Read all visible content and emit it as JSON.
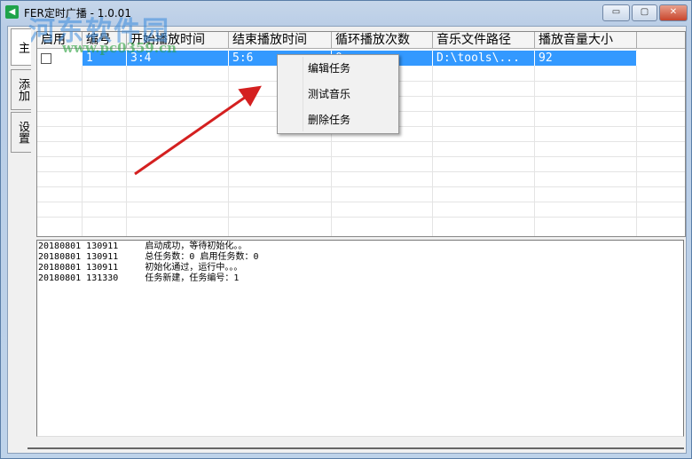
{
  "window": {
    "title": "FER定时广播 - 1.0.01",
    "minimize": "▭",
    "maximize": "▢",
    "close": "✕"
  },
  "tabs": [
    "主",
    "添加",
    "设置"
  ],
  "table": {
    "headers": [
      "启用",
      "编号",
      "开始播放时间",
      "结束播放时间",
      "循环播放次数",
      "音乐文件路径",
      "播放音量大小"
    ],
    "rows": [
      {
        "enabled": false,
        "id": "1",
        "start": "3:4",
        "end": "5:6",
        "loops": "0",
        "path": "D:\\tools\\...",
        "volume": "92"
      }
    ]
  },
  "log": [
    "20180801 130911     启动成功，等待初始化。。",
    "20180801 130911     总任务数：0 启用任务数：0",
    "20180801 130911     初始化通过，运行中。。。",
    "20180801 131330     任务新建，任务编号：1"
  ],
  "context_menu": [
    "编辑任务",
    "测试音乐",
    "删除任务"
  ],
  "watermark": {
    "name": "河东软件园",
    "url": "www.pc0359.cn"
  },
  "colors": {
    "selection": "#3399ff",
    "arrow": "#d42020"
  }
}
